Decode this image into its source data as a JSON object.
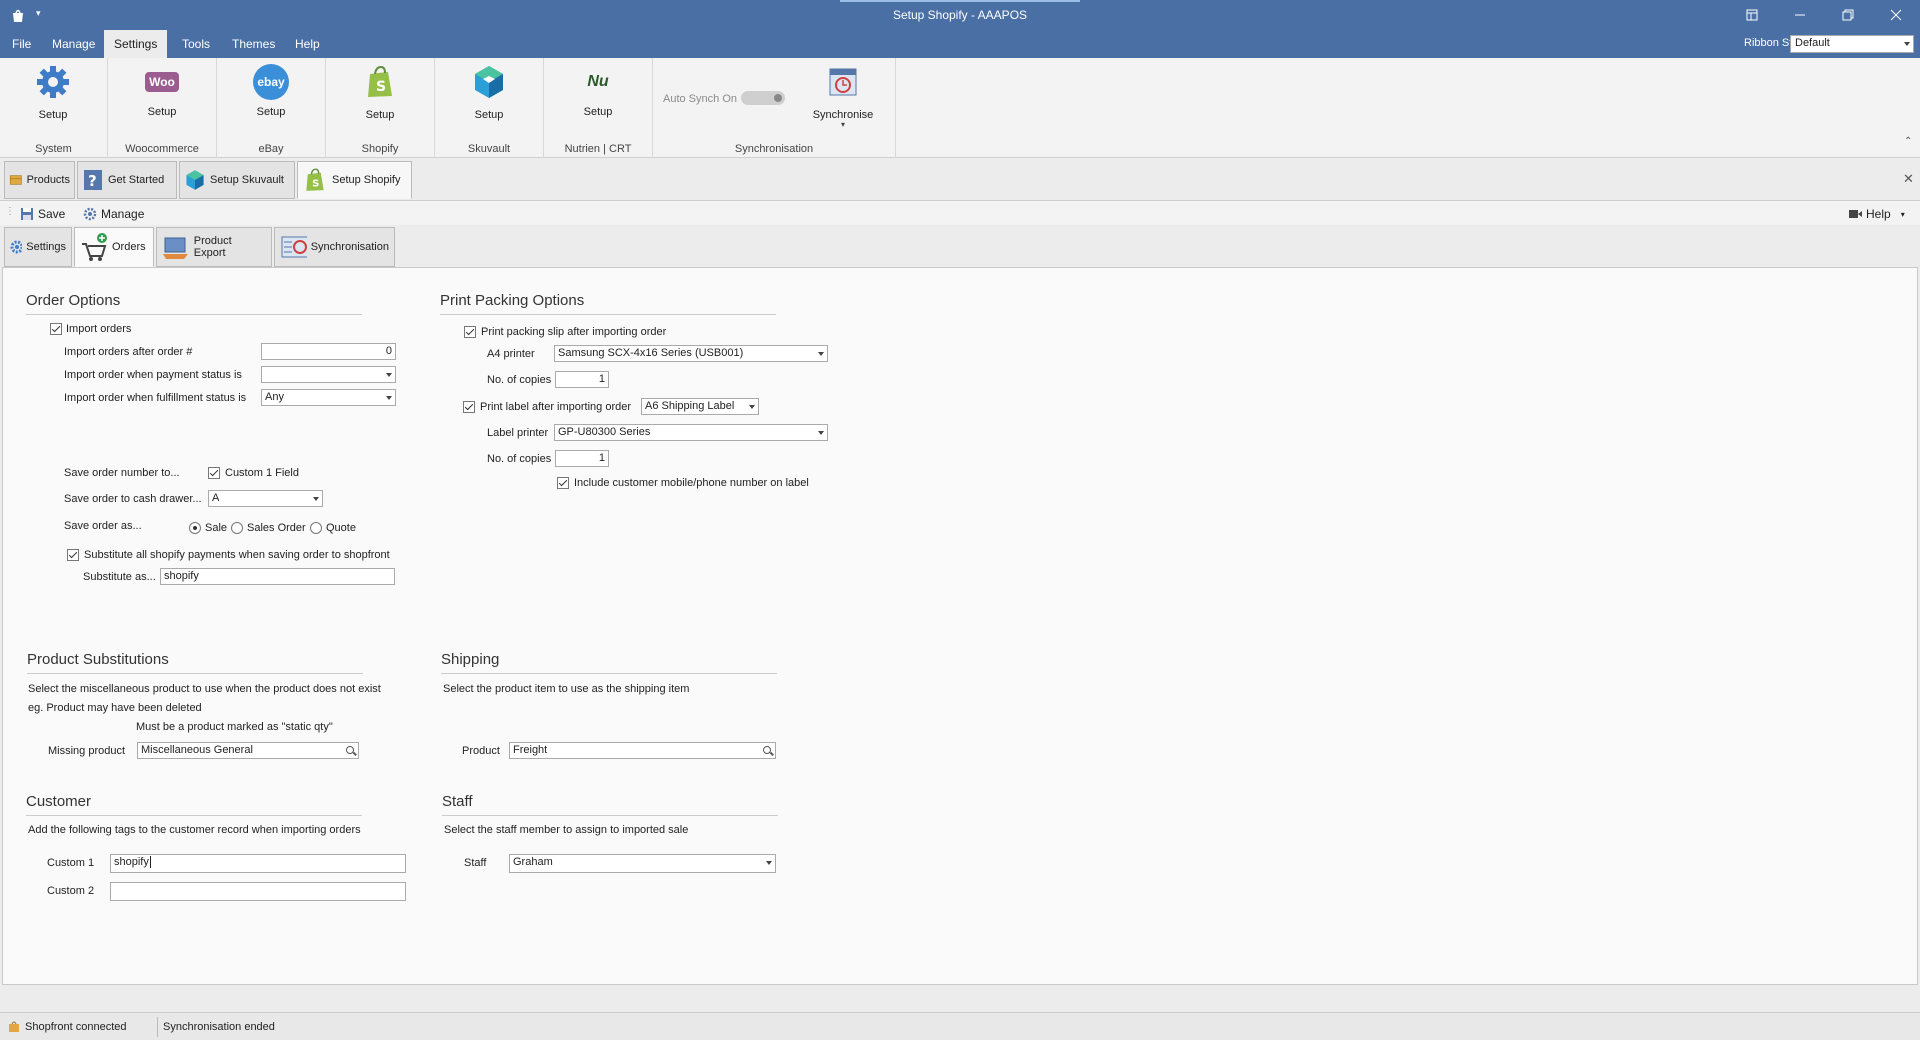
{
  "window": {
    "title": "Setup Shopify - AAAPOS"
  },
  "menu": [
    "File",
    "Manage",
    "Settings",
    "Tools",
    "Themes",
    "Help"
  ],
  "ribbon_style": {
    "label": "Ribbon Style",
    "value": "Default"
  },
  "ribbon": {
    "system": {
      "button": "Setup",
      "group": "System"
    },
    "woocommerce": {
      "button": "Setup",
      "group": "Woocommerce",
      "logo": "Woo"
    },
    "ebay": {
      "button": "Setup",
      "group": "eBay",
      "logo": "ebay"
    },
    "shopify": {
      "button": "Setup",
      "group": "Shopify"
    },
    "skuvault": {
      "button": "Setup",
      "group": "Skuvault"
    },
    "nutrien": {
      "button": "Setup",
      "group": "Nutrien | CRT",
      "logo": "Nu"
    },
    "sync": {
      "toggle_label": "Auto Synch On",
      "button": "Synchronise",
      "group": "Synchronisation"
    }
  },
  "doc_tabs": [
    "Products",
    "Get Started",
    "Setup Skuvault",
    "Setup Shopify"
  ],
  "toolbar": {
    "save": "Save",
    "manage": "Manage",
    "help": "Help"
  },
  "sub_tabs": [
    "Settings",
    "Orders",
    "Product Export",
    "Synchronisation"
  ],
  "order_options": {
    "title": "Order Options",
    "import_orders": "Import orders",
    "after_order_label": "Import orders after order #",
    "after_order_value": "0",
    "payment_status_label": "Import order when payment status is",
    "payment_status_value": "",
    "fulfillment_label": "Import order when fulfillment status is",
    "fulfillment_value": "Any",
    "save_number_label": "Save order number to...",
    "save_number_field": "Custom 1 Field",
    "cash_drawer_label": "Save order to cash drawer...",
    "cash_drawer_value": "A",
    "save_as_label": "Save order as...",
    "save_as_options": [
      "Sale",
      "Sales Order",
      "Quote"
    ],
    "substitute_label": "Substitute all shopify payments when saving order to shopfront",
    "substitute_as_label": "Substitute as...",
    "substitute_as_value": "shopify"
  },
  "print_packing": {
    "title": "Print Packing Options",
    "packing_slip": "Print packing slip after importing order",
    "a4_printer_label": "A4 printer",
    "a4_printer_value": "Samsung SCX-4x16 Series (USB001)",
    "copies_label": "No. of copies",
    "copies_value": "1",
    "print_label": "Print label after importing order",
    "label_type": "A6 Shipping Label",
    "label_printer_label": "Label printer",
    "label_printer_value": "GP-U80300 Series",
    "label_copies_label": "No. of copies",
    "label_copies_value": "1",
    "include_phone": "Include customer mobile/phone number on label"
  },
  "product_subs": {
    "title": "Product Substitutions",
    "desc1": "Select the miscellaneous product to use when the product does not exist",
    "desc2": "eg. Product may have been deleted",
    "note": "Must be a product marked as \"static qty\"",
    "missing_label": "Missing product",
    "missing_value": "Miscellaneous General"
  },
  "shipping": {
    "title": "Shipping",
    "desc": "Select the product item to use as the shipping item",
    "product_label": "Product",
    "product_value": "Freight"
  },
  "customer": {
    "title": "Customer",
    "desc": "Add the following tags to the customer record when importing orders",
    "custom1_label": "Custom 1",
    "custom1_value": "shopify",
    "custom2_label": "Custom 2",
    "custom2_value": ""
  },
  "staff": {
    "title": "Staff",
    "desc": "Select the staff member to assign to imported sale",
    "label": "Staff",
    "value": "Graham"
  },
  "status": {
    "left": "Shopfront connected",
    "right": "Synchronisation ended"
  }
}
